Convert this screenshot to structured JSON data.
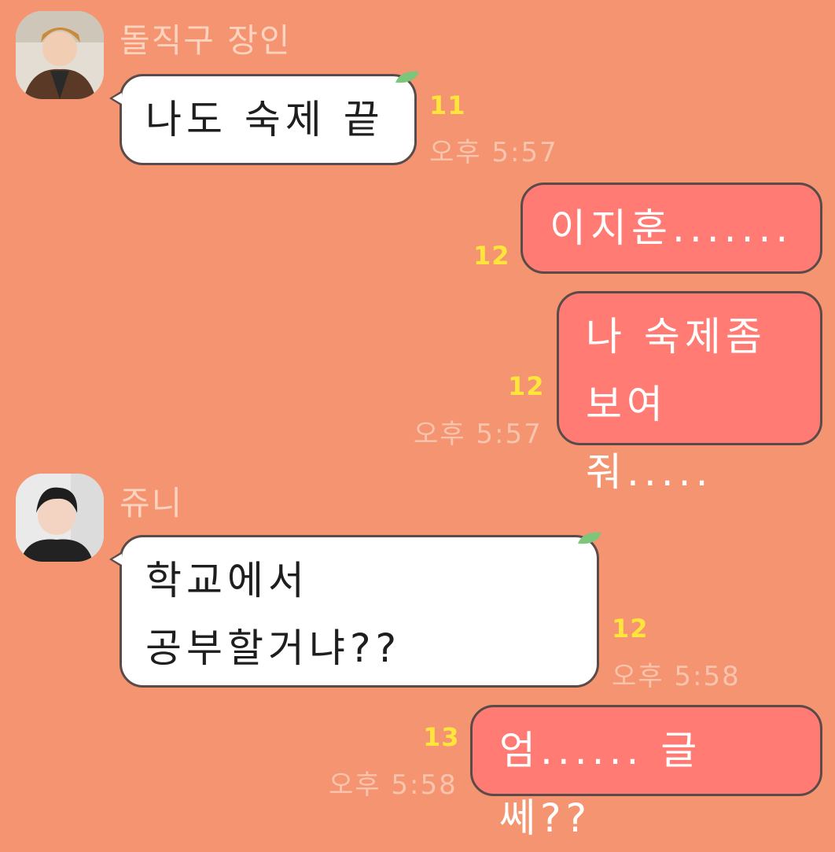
{
  "messages": [
    {
      "sender": "돌직구 장인",
      "direction": "in",
      "lines": [
        "나도 숙제 끝"
      ],
      "unread": "11",
      "time": "오후 5:57"
    },
    {
      "direction": "out",
      "lines": [
        "이지훈......."
      ],
      "unread": "12",
      "time": ""
    },
    {
      "direction": "out",
      "lines": [
        "나 숙제좀",
        "보여줘....."
      ],
      "unread": "12",
      "time": "오후 5:57"
    },
    {
      "sender": "쥬니",
      "direction": "in",
      "lines": [
        "학교에서",
        "공부할거냐??"
      ],
      "unread": "12",
      "time": "오후 5:58"
    },
    {
      "direction": "out",
      "lines": [
        "엄...... 글쎄??"
      ],
      "unread": "13",
      "time": "오후 5:58"
    }
  ],
  "icons": {
    "leaf": "leaf-icon",
    "avatar": "avatar-photo"
  },
  "colors": {
    "background": "#F49470",
    "bubble_in": "#FFFFFF",
    "bubble_out": "#FF7B73",
    "unread": "#FFE53B",
    "time": "#F9C4AD"
  }
}
